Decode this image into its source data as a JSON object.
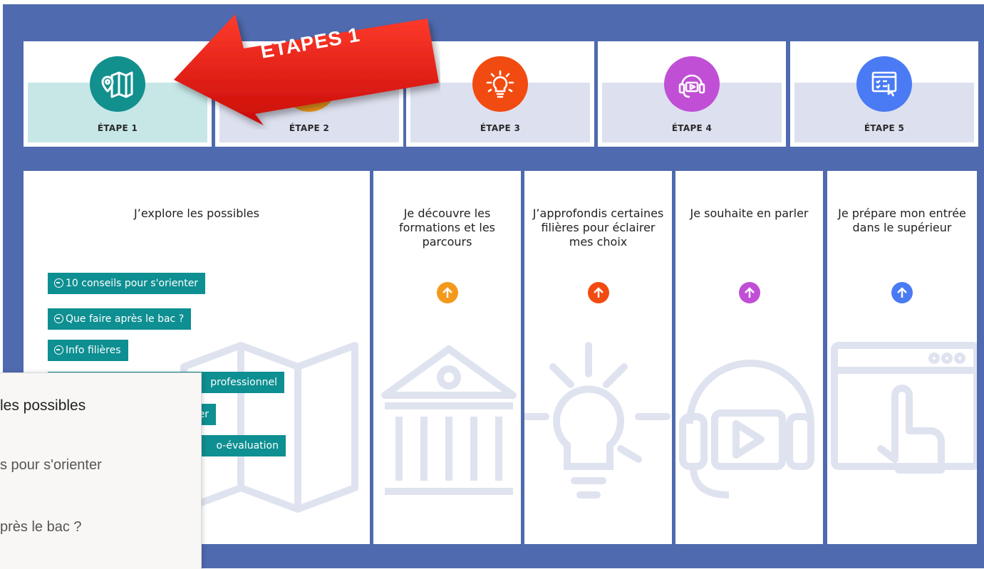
{
  "steps": [
    {
      "label": "ÉTAPE 1",
      "icon": "map-pin-icon",
      "color": "#11908e",
      "band": "#c7e7e7"
    },
    {
      "label": "ÉTAPE 2",
      "icon": "institution-icon",
      "color": "#f39a1c",
      "band": "#dde1ef"
    },
    {
      "label": "ÉTAPE 3",
      "icon": "lightbulb-ideas-icon",
      "color": "#f24b11",
      "band": "#dde1ef"
    },
    {
      "label": "ÉTAPE 4",
      "icon": "headset-video-icon",
      "color": "#c04fd6",
      "band": "#dde1ef"
    },
    {
      "label": "ÉTAPE 5",
      "icon": "screen-checklist-icon",
      "color": "#4a7bf4",
      "band": "#dde1ef"
    }
  ],
  "columns": [
    {
      "title": "J’explore les possibles",
      "bg_icon": "map-icon"
    },
    {
      "title": "Je découvre les formations et les parcours",
      "bg_icon": "institution-icon",
      "arrow_color": "#f39a1c"
    },
    {
      "title": "J’approfondis certaines filières pour éclairer mes choix",
      "bg_icon": "lightbulb-ideas-icon",
      "arrow_color": "#f24b11"
    },
    {
      "title": "Je souhaite en parler",
      "bg_icon": "headset-video-icon",
      "arrow_color": "#c04fd6"
    },
    {
      "title": "Je prépare mon entrée dans le supérieur",
      "bg_icon": "screen-pointer-icon",
      "arrow_color": "#4a7bf4"
    }
  ],
  "links": [
    "10 conseils pour s'orienter",
    "Que faire après le bac ?",
    "Info filières",
    "professionnel",
    "er",
    "o-évaluation"
  ],
  "popup": {
    "title": "les possibles",
    "items": [
      "s pour s'orienter",
      "près le bac ?"
    ]
  },
  "annotation": {
    "text": "ETAPES 1",
    "color": "#e8100c"
  }
}
